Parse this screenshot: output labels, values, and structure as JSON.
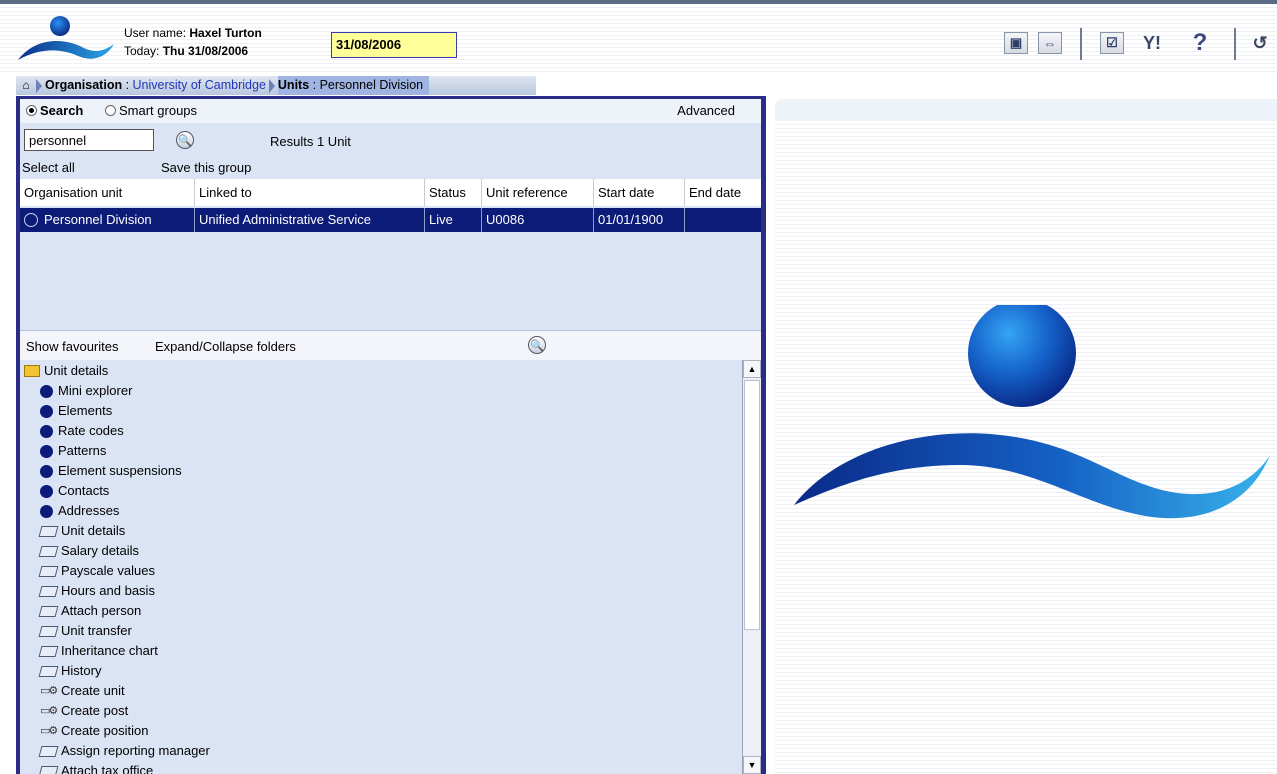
{
  "header": {
    "user_label": "User name: ",
    "user_name": "Haxel Turton",
    "today_label": "Today: ",
    "today_value": "Thu 31/08/2006",
    "date_field": "31/08/2006",
    "toolbar_icons": [
      "screen-icon",
      "expand-icon",
      "checklist-icon",
      "tools-icon",
      "help-icon",
      "exit-icon"
    ]
  },
  "breadcrumb": {
    "org_label": "Organisation",
    "org_value": "University of Cambridge",
    "units_label": "Units",
    "units_value": "Personnel Division"
  },
  "search": {
    "tab_search": "Search",
    "tab_smart_groups": "Smart groups",
    "advanced": "Advanced",
    "query": "personnel",
    "results": "Results 1 Unit",
    "select_all": "Select all",
    "save_group": "Save this group"
  },
  "table": {
    "columns": [
      "Organisation unit",
      "Linked to",
      "Status",
      "Unit reference",
      "Start date",
      "End date"
    ],
    "rows": [
      [
        "Personnel Division",
        "Unified Administrative Service",
        "Live",
        "U0086",
        "01/01/1900",
        ""
      ]
    ]
  },
  "favourites": {
    "show_favourites": "Show favourites",
    "expand_collapse": "Expand/Collapse folders"
  },
  "tree": {
    "folder": "Unit details",
    "items": [
      {
        "label": "Mini explorer",
        "icon": "dot"
      },
      {
        "label": "Elements",
        "icon": "dot"
      },
      {
        "label": "Rate codes",
        "icon": "dot"
      },
      {
        "label": "Patterns",
        "icon": "dot"
      },
      {
        "label": "Element suspensions",
        "icon": "dot"
      },
      {
        "label": "Contacts",
        "icon": "dot"
      },
      {
        "label": "Addresses",
        "icon": "dot"
      },
      {
        "label": "Unit details",
        "icon": "form"
      },
      {
        "label": "Salary details",
        "icon": "form"
      },
      {
        "label": "Payscale values",
        "icon": "form"
      },
      {
        "label": "Hours and basis",
        "icon": "form"
      },
      {
        "label": "Attach person",
        "icon": "form"
      },
      {
        "label": "Unit transfer",
        "icon": "form"
      },
      {
        "label": "Inheritance chart",
        "icon": "form"
      },
      {
        "label": "History",
        "icon": "form"
      },
      {
        "label": "Create unit",
        "icon": "gear"
      },
      {
        "label": "Create post",
        "icon": "gear"
      },
      {
        "label": "Create position",
        "icon": "gear"
      },
      {
        "label": "Assign reporting manager",
        "icon": "form"
      },
      {
        "label": "Attach tax office",
        "icon": "form"
      }
    ]
  },
  "colors": {
    "selected_row": "#0c1a78",
    "panel_border": "#2b2b88",
    "panel_bg": "#dbe4f4",
    "date_bg": "#ffff99"
  }
}
